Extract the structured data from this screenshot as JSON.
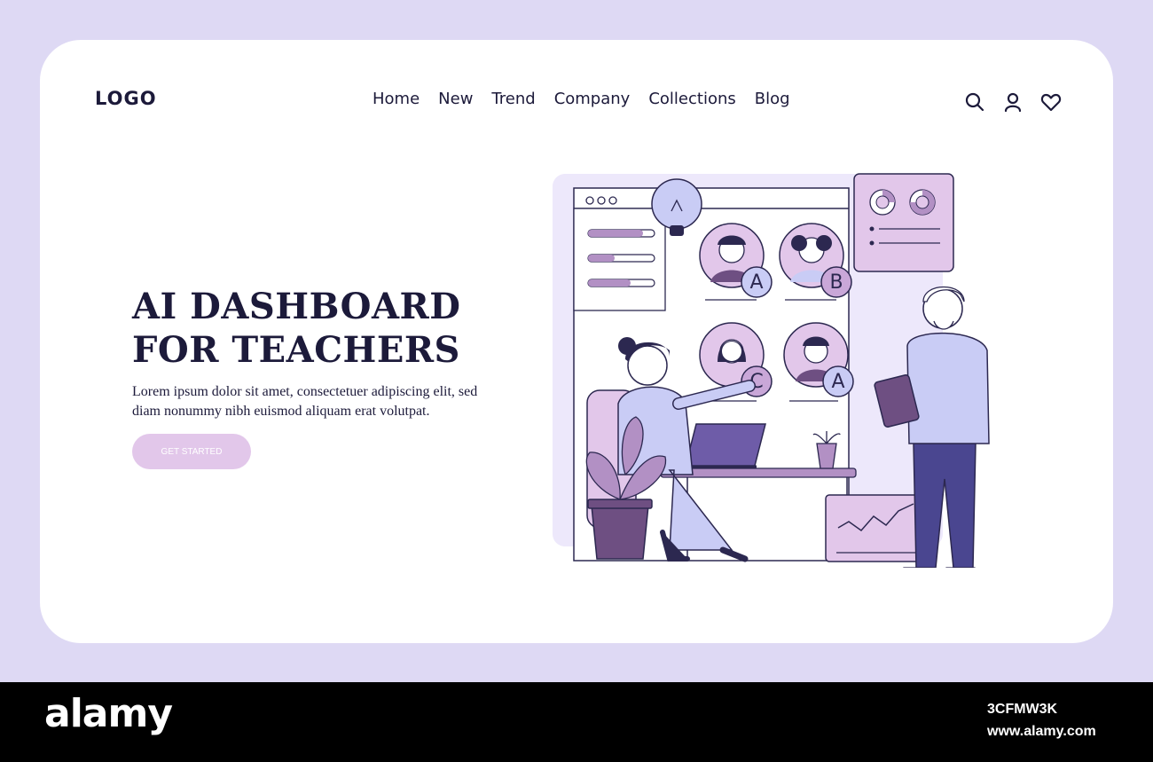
{
  "header": {
    "logo": "LOGO",
    "nav": [
      {
        "label": "Home"
      },
      {
        "label": "New"
      },
      {
        "label": "Trend"
      },
      {
        "label": "Company"
      },
      {
        "label": "Collections"
      },
      {
        "label": "Blog"
      }
    ],
    "icons": [
      "search-icon",
      "user-icon",
      "heart-icon"
    ]
  },
  "hero": {
    "title": "AI DASHBOARD\nFOR TEACHERS",
    "body": "Lorem ipsum dolor sit amet, consectetuer adipiscing elit, sed diam nonummy nibh euismod aliquam erat volutpat.",
    "cta": "GET STARTED"
  },
  "illustration": {
    "grades": [
      "A",
      "B",
      "C",
      "A"
    ]
  },
  "footer": {
    "brand": "alamy",
    "image_id": "3CFMW3K",
    "url": "www.alamy.com"
  },
  "colors": {
    "background": "#ded9f4",
    "card": "#ffffff",
    "text": "#1c1a3a",
    "accent_purple": "#c9a7d8",
    "button": "#e2c7ea",
    "light_blue": "#c9ccf5",
    "dark_purple": "#6e4f82"
  }
}
